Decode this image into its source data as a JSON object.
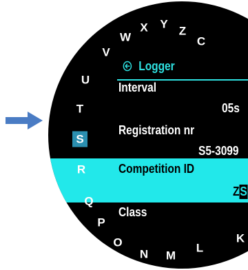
{
  "colors": {
    "arrow": "#4a7cc4",
    "selected_letter_bg": "#2b8fb0",
    "accent": "#2ee1e1",
    "highlight_row": "#22e8ea",
    "bezel": "#000000"
  },
  "ring_letters": [
    "W",
    "X",
    "Y",
    "Z",
    "C",
    "V",
    "U",
    "T",
    "S",
    "R",
    "Q",
    "P",
    "O",
    "N",
    "M",
    "L",
    "K"
  ],
  "selected_letter": "S",
  "menu": {
    "back_icon": "back-circle-arrow-icon",
    "title": "Logger",
    "items": [
      {
        "label": "Interval",
        "value": "05s"
      },
      {
        "label": "Registration nr",
        "value": "S5-3099"
      },
      {
        "label": "Competition ID",
        "value_prefix": "Z",
        "value_cursor": "S",
        "selected": true
      },
      {
        "label": "Class"
      }
    ]
  }
}
